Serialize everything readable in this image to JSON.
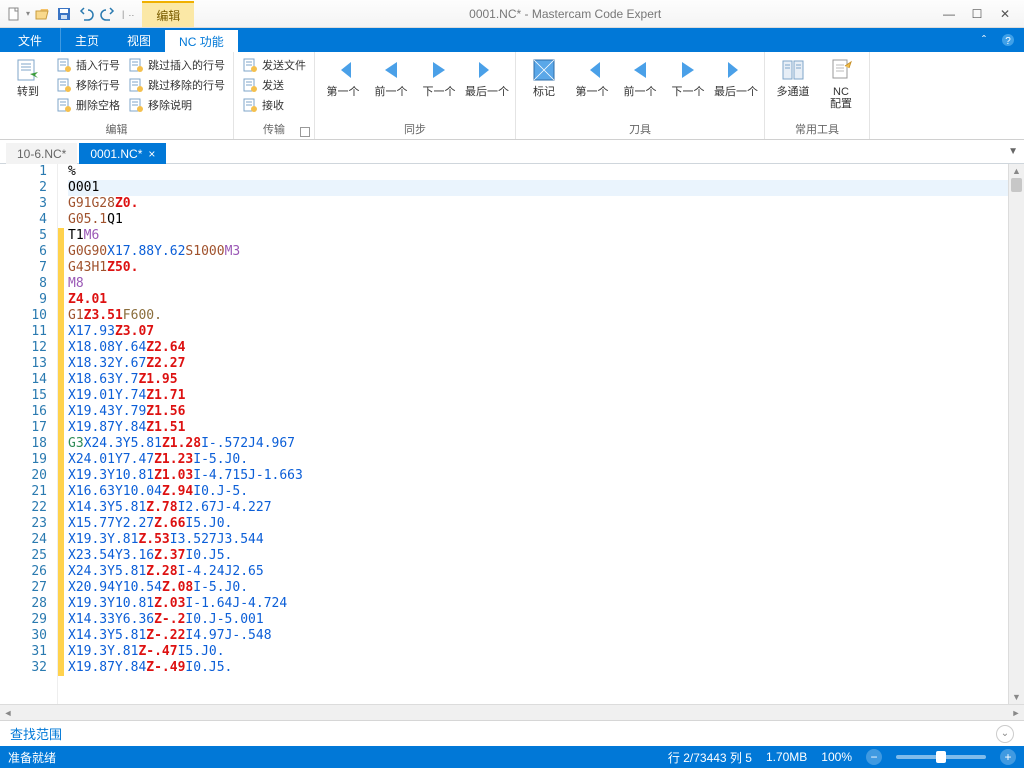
{
  "window": {
    "title": "0001.NC* - Mastercam Code Expert",
    "contextual_tab": "编辑"
  },
  "qat": {
    "items": [
      "new",
      "open",
      "save",
      "undo",
      "redo",
      "more"
    ]
  },
  "ribbon_tabs": {
    "file": "文件",
    "tabs": [
      "主页",
      "视图",
      "NC 功能"
    ],
    "active_index": 2
  },
  "ribbon": {
    "groups": [
      {
        "label": "编辑",
        "big": [
          {
            "key": "goto",
            "label": "转到"
          }
        ],
        "cols": [
          [
            {
              "icon": "insert-line",
              "label": "插入行号"
            },
            {
              "icon": "remove-line",
              "label": "移除行号"
            },
            {
              "icon": "delete-space",
              "label": "删除空格"
            }
          ],
          [
            {
              "icon": "skip-insert",
              "label": "跳过插入的行号"
            },
            {
              "icon": "skip-remove",
              "label": "跳过移除的行号"
            },
            {
              "icon": "remove-comment",
              "label": "移除说明"
            }
          ]
        ]
      },
      {
        "label": "传输",
        "cols": [
          [
            {
              "icon": "send-file",
              "label": "发送文件"
            },
            {
              "icon": "send",
              "label": "发送"
            },
            {
              "icon": "receive",
              "label": "接收"
            }
          ]
        ],
        "has_launcher": true
      },
      {
        "label": "同步",
        "big": [
          {
            "key": "first",
            "label": "第一个"
          },
          {
            "key": "prev",
            "label": "前一个"
          },
          {
            "key": "next",
            "label": "下一个"
          },
          {
            "key": "last",
            "label": "最后一个"
          }
        ]
      },
      {
        "label": "刀具",
        "big": [
          {
            "key": "toolmark",
            "label": "标记",
            "shape": "square"
          },
          {
            "key": "tfirst",
            "label": "第一个"
          },
          {
            "key": "tprev",
            "label": "前一个"
          },
          {
            "key": "tnext",
            "label": "下一个"
          },
          {
            "key": "tlast",
            "label": "最后一个"
          }
        ]
      },
      {
        "label": "常用工具",
        "big": [
          {
            "key": "multichannel",
            "label": "多通道",
            "shape": "book"
          },
          {
            "key": "ncconfig",
            "label": "NC\n配置",
            "shape": "doc"
          }
        ]
      }
    ]
  },
  "doc_tabs": {
    "tabs": [
      {
        "label": "10-6.NC*",
        "active": false
      },
      {
        "label": "0001.NC*",
        "active": true
      }
    ]
  },
  "code": {
    "highlight_line": 2,
    "lines": [
      [
        {
          "c": "t-k",
          "t": "%"
        }
      ],
      [
        {
          "c": "t-k",
          "t": "O001"
        }
      ],
      [
        {
          "c": "t-g",
          "t": "G91"
        },
        {
          "c": "t-g",
          "t": " G28"
        },
        {
          "c": "t-z",
          "t": " Z0."
        }
      ],
      [
        {
          "c": "t-g",
          "t": "G05.1"
        },
        {
          "c": "t-k",
          "t": " Q1"
        }
      ],
      [
        {
          "c": "t-k",
          "t": "T1"
        },
        {
          "c": "t-m",
          "t": " M6"
        }
      ],
      [
        {
          "c": "t-g",
          "t": "G0"
        },
        {
          "c": "t-g",
          "t": " G90"
        },
        {
          "c": "t-xy",
          "t": " X17.88"
        },
        {
          "c": "t-xy",
          "t": " Y.62"
        },
        {
          "c": "t-s",
          "t": " S1000"
        },
        {
          "c": "t-m",
          "t": " M3"
        }
      ],
      [
        {
          "c": "t-g",
          "t": "G43"
        },
        {
          "c": "t-h",
          "t": " H1"
        },
        {
          "c": "t-z",
          "t": " Z50."
        }
      ],
      [
        {
          "c": "t-m",
          "t": "M8"
        }
      ],
      [
        {
          "c": "t-z",
          "t": "Z4.01"
        }
      ],
      [
        {
          "c": "t-g",
          "t": "G1"
        },
        {
          "c": "t-z",
          "t": " Z3.51"
        },
        {
          "c": "t-f",
          "t": " F600."
        }
      ],
      [
        {
          "c": "t-xy",
          "t": "X17.93"
        },
        {
          "c": "t-z",
          "t": " Z3.07"
        }
      ],
      [
        {
          "c": "t-xy",
          "t": "X18.08"
        },
        {
          "c": "t-xy",
          "t": " Y.64"
        },
        {
          "c": "t-z",
          "t": " Z2.64"
        }
      ],
      [
        {
          "c": "t-xy",
          "t": "X18.32"
        },
        {
          "c": "t-xy",
          "t": " Y.67"
        },
        {
          "c": "t-z",
          "t": " Z2.27"
        }
      ],
      [
        {
          "c": "t-xy",
          "t": "X18.63"
        },
        {
          "c": "t-xy",
          "t": " Y.7"
        },
        {
          "c": "t-z",
          "t": " Z1.95"
        }
      ],
      [
        {
          "c": "t-xy",
          "t": "X19.01"
        },
        {
          "c": "t-xy",
          "t": " Y.74"
        },
        {
          "c": "t-z",
          "t": " Z1.71"
        }
      ],
      [
        {
          "c": "t-xy",
          "t": "X19.43"
        },
        {
          "c": "t-xy",
          "t": " Y.79"
        },
        {
          "c": "t-z",
          "t": " Z1.56"
        }
      ],
      [
        {
          "c": "t-xy",
          "t": "X19.87"
        },
        {
          "c": "t-xy",
          "t": " Y.84"
        },
        {
          "c": "t-z",
          "t": " Z1.51"
        }
      ],
      [
        {
          "c": "t-g3",
          "t": "G3"
        },
        {
          "c": "t-xy",
          "t": " X24.3"
        },
        {
          "c": "t-xy",
          "t": " Y5.81"
        },
        {
          "c": "t-z",
          "t": " Z1.28"
        },
        {
          "c": "t-xy",
          "t": " I-.572"
        },
        {
          "c": "t-xy",
          "t": " J4.967"
        }
      ],
      [
        {
          "c": "t-xy",
          "t": "X24.01"
        },
        {
          "c": "t-xy",
          "t": " Y7.47"
        },
        {
          "c": "t-z",
          "t": " Z1.23"
        },
        {
          "c": "t-xy",
          "t": " I-5."
        },
        {
          "c": "t-xy",
          "t": " J0."
        }
      ],
      [
        {
          "c": "t-xy",
          "t": "X19.3"
        },
        {
          "c": "t-xy",
          "t": " Y10.81"
        },
        {
          "c": "t-z",
          "t": " Z1.03"
        },
        {
          "c": "t-xy",
          "t": " I-4.715"
        },
        {
          "c": "t-xy",
          "t": " J-1.663"
        }
      ],
      [
        {
          "c": "t-xy",
          "t": "X16.63"
        },
        {
          "c": "t-xy",
          "t": " Y10.04"
        },
        {
          "c": "t-z",
          "t": " Z.94"
        },
        {
          "c": "t-xy",
          "t": " I0."
        },
        {
          "c": "t-xy",
          "t": " J-5."
        }
      ],
      [
        {
          "c": "t-xy",
          "t": "X14.3"
        },
        {
          "c": "t-xy",
          "t": " Y5.81"
        },
        {
          "c": "t-z",
          "t": " Z.78"
        },
        {
          "c": "t-xy",
          "t": " I2.67"
        },
        {
          "c": "t-xy",
          "t": " J-4.227"
        }
      ],
      [
        {
          "c": "t-xy",
          "t": "X15.77"
        },
        {
          "c": "t-xy",
          "t": " Y2.27"
        },
        {
          "c": "t-z",
          "t": " Z.66"
        },
        {
          "c": "t-xy",
          "t": " I5."
        },
        {
          "c": "t-xy",
          "t": " J0."
        }
      ],
      [
        {
          "c": "t-xy",
          "t": "X19.3"
        },
        {
          "c": "t-xy",
          "t": " Y.81"
        },
        {
          "c": "t-z",
          "t": " Z.53"
        },
        {
          "c": "t-xy",
          "t": " I3.527"
        },
        {
          "c": "t-xy",
          "t": " J3.544"
        }
      ],
      [
        {
          "c": "t-xy",
          "t": "X23.54"
        },
        {
          "c": "t-xy",
          "t": " Y3.16"
        },
        {
          "c": "t-z",
          "t": " Z.37"
        },
        {
          "c": "t-xy",
          "t": " I0."
        },
        {
          "c": "t-xy",
          "t": " J5."
        }
      ],
      [
        {
          "c": "t-xy",
          "t": "X24.3"
        },
        {
          "c": "t-xy",
          "t": " Y5.81"
        },
        {
          "c": "t-z",
          "t": " Z.28"
        },
        {
          "c": "t-xy",
          "t": " I-4.24"
        },
        {
          "c": "t-xy",
          "t": " J2.65"
        }
      ],
      [
        {
          "c": "t-xy",
          "t": "X20.94"
        },
        {
          "c": "t-xy",
          "t": " Y10.54"
        },
        {
          "c": "t-z",
          "t": " Z.08"
        },
        {
          "c": "t-xy",
          "t": " I-5."
        },
        {
          "c": "t-xy",
          "t": " J0."
        }
      ],
      [
        {
          "c": "t-xy",
          "t": "X19.3"
        },
        {
          "c": "t-xy",
          "t": " Y10.81"
        },
        {
          "c": "t-z",
          "t": " Z.03"
        },
        {
          "c": "t-xy",
          "t": " I-1.64"
        },
        {
          "c": "t-xy",
          "t": " J-4.724"
        }
      ],
      [
        {
          "c": "t-xy",
          "t": "X14.33"
        },
        {
          "c": "t-xy",
          "t": " Y6.36"
        },
        {
          "c": "t-z",
          "t": " Z-.2"
        },
        {
          "c": "t-xy",
          "t": " I0."
        },
        {
          "c": "t-xy",
          "t": " J-5.001"
        }
      ],
      [
        {
          "c": "t-xy",
          "t": "X14.3"
        },
        {
          "c": "t-xy",
          "t": " Y5.81"
        },
        {
          "c": "t-z",
          "t": " Z-.22"
        },
        {
          "c": "t-xy",
          "t": " I4.97"
        },
        {
          "c": "t-xy",
          "t": " J-.548"
        }
      ],
      [
        {
          "c": "t-xy",
          "t": "X19.3"
        },
        {
          "c": "t-xy",
          "t": " Y.81"
        },
        {
          "c": "t-z",
          "t": " Z-.47"
        },
        {
          "c": "t-xy",
          "t": " I5."
        },
        {
          "c": "t-xy",
          "t": " J0."
        }
      ],
      [
        {
          "c": "t-xy",
          "t": "X19.87"
        },
        {
          "c": "t-xy",
          "t": " Y.84"
        },
        {
          "c": "t-z",
          "t": " Z-.49"
        },
        {
          "c": "t-xy",
          "t": " I0."
        },
        {
          "c": "t-xy",
          "t": " J5."
        }
      ]
    ]
  },
  "find": {
    "label": "查找范围"
  },
  "status": {
    "ready": "准备就绪",
    "pos": "行 2/73443  列 5",
    "size": "1.70MB",
    "zoom": "100%"
  }
}
